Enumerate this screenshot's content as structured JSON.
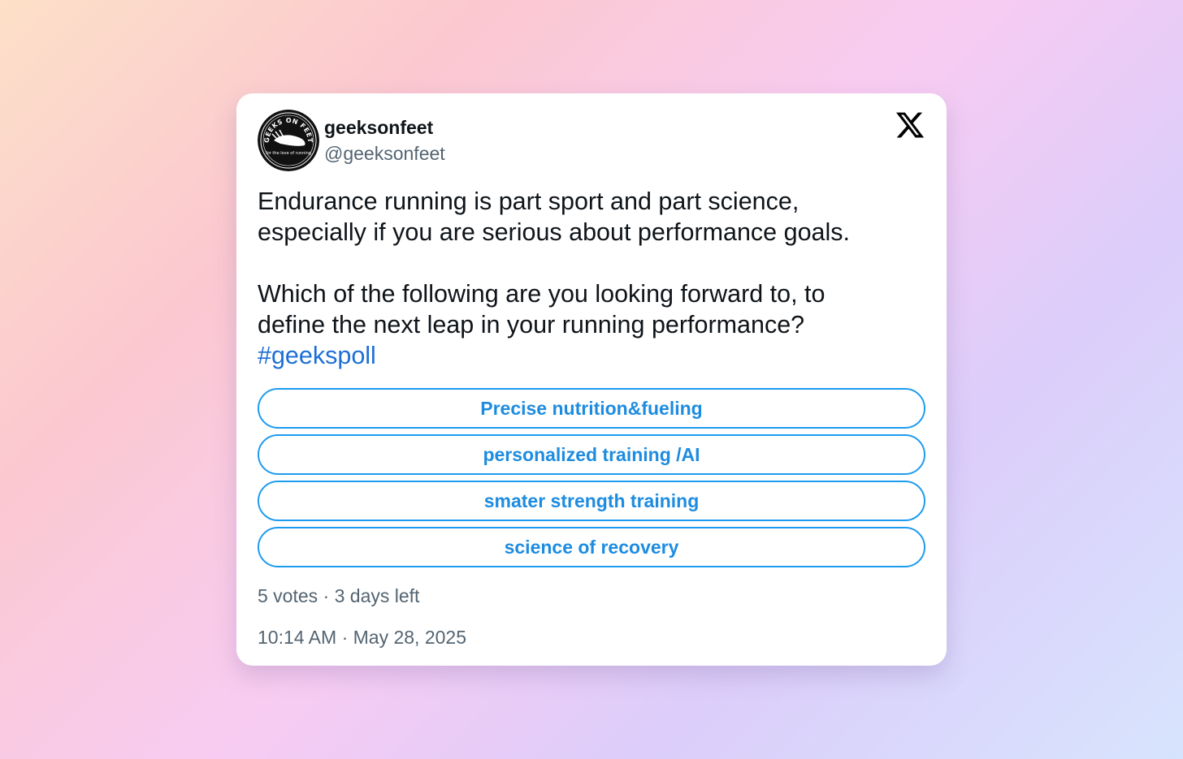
{
  "tweet": {
    "display_name": "geeksonfeet",
    "handle": "@geeksonfeet",
    "avatar": {
      "icon": "geeks-on-feet-logo",
      "logo_text_top": "GEEKS ON FEET",
      "logo_text_bottom": "for the love of running"
    },
    "brand_icon": "x-logo-icon",
    "text": {
      "paragraph1_line1": "Endurance running is part sport and part science,",
      "paragraph1_line2": "especially if you are serious about performance goals.",
      "paragraph2_line1": "Which of the following are you looking forward to, to",
      "paragraph2_line2": "define the next leap in your running performance?",
      "hashtag": "#geekspoll"
    },
    "poll": {
      "options": [
        {
          "label": "Precise nutrition&fueling"
        },
        {
          "label": "personalized training /AI"
        },
        {
          "label": "smater strength training"
        },
        {
          "label": "science of recovery"
        }
      ],
      "meta": "5 votes · 3 days left"
    },
    "timestamp": "10:14 AM · May 28, 2025"
  },
  "colors": {
    "accent": "#1d9bf0",
    "hashtag": "#1d6fd6",
    "text_primary": "#0f1419",
    "text_secondary": "#536471"
  }
}
